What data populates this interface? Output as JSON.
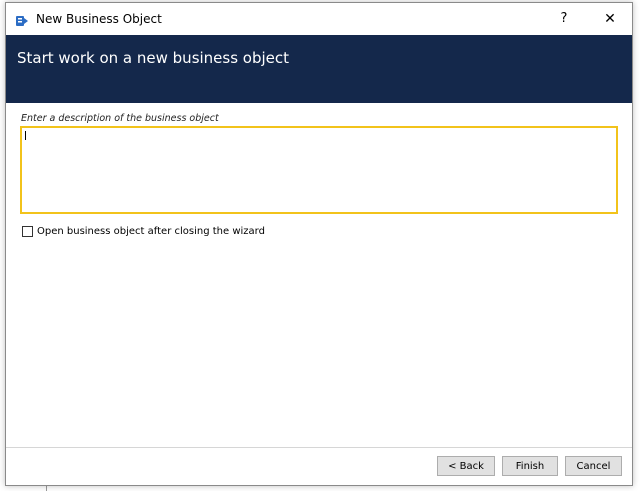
{
  "window": {
    "title": "New Business Object",
    "help_label": "?",
    "close_label": "✕"
  },
  "banner": {
    "title": "Start work on a new business object"
  },
  "form": {
    "description_label": "Enter a description of the business object",
    "description_value": "",
    "open_after_close_label": "Open business object after closing the wizard",
    "open_after_close_checked": false
  },
  "footer": {
    "back_label": "< Back",
    "finish_label": "Finish",
    "cancel_label": "Cancel"
  },
  "colors": {
    "banner_bg": "#14284b",
    "input_focus_border": "#f2c31b"
  },
  "icons": {
    "app": "business-object-app-icon",
    "close": "close-icon"
  }
}
